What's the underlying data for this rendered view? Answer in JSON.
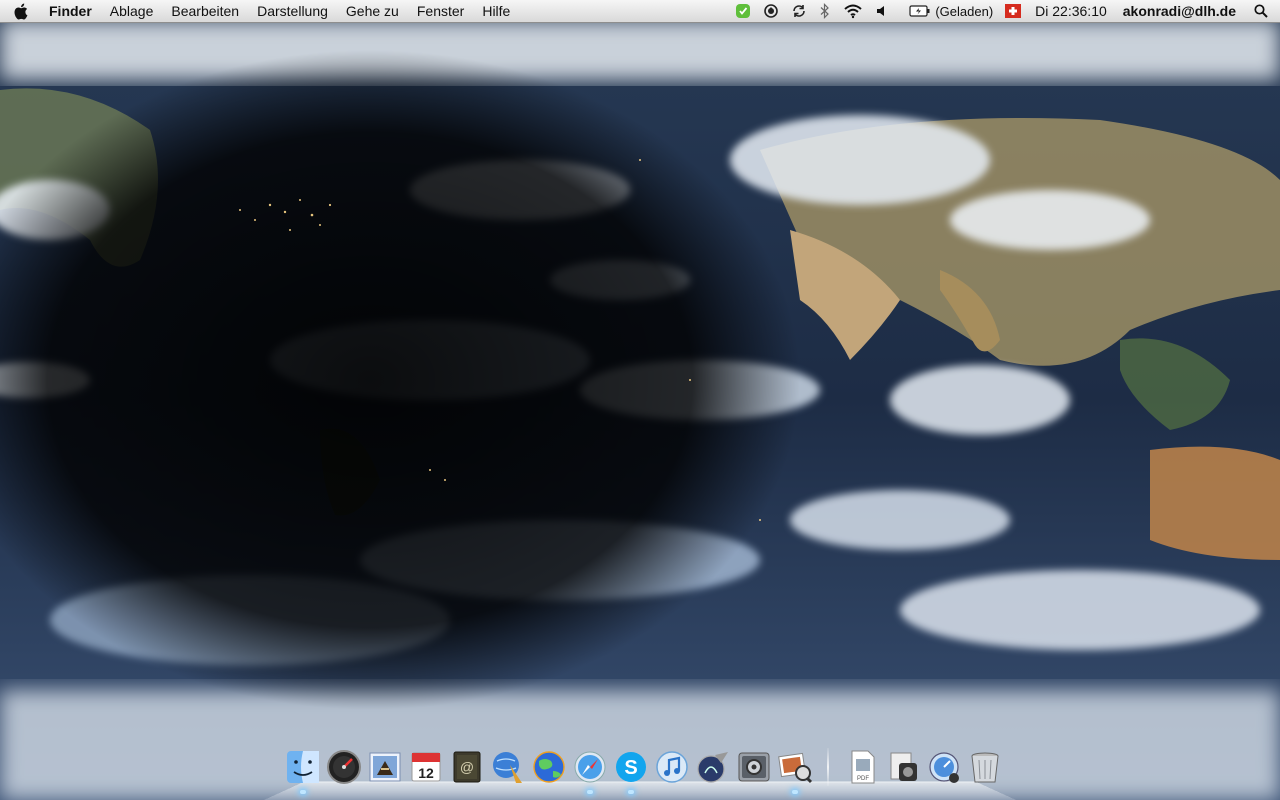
{
  "menubar": {
    "apple_icon": "apple-logo-icon",
    "app_name": "Finder",
    "menus": [
      "Ablage",
      "Bearbeiten",
      "Darstellung",
      "Gehe zu",
      "Fenster",
      "Hilfe"
    ],
    "status_icons": [
      "evernote-icon",
      "time-machine-icon",
      "sync-icon",
      "bluetooth-icon",
      "wifi-icon",
      "volume-icon",
      "battery-icon"
    ],
    "battery_text": "(Geladen)",
    "input_source_icon": "swiss-flag-icon",
    "clock": "Di 22:36:10",
    "user": "akonradi@dlh.de",
    "spotlight_icon": "spotlight-search-icon"
  },
  "dock": {
    "apps": [
      {
        "name": "finder-icon",
        "running": true
      },
      {
        "name": "dashboard-icon",
        "running": false
      },
      {
        "name": "mail-icon",
        "running": false
      },
      {
        "name": "ical-icon",
        "label": "12",
        "running": false
      },
      {
        "name": "address-book-icon",
        "running": false
      },
      {
        "name": "network-utility-icon",
        "running": false
      },
      {
        "name": "globe-icon",
        "running": false
      },
      {
        "name": "safari-icon",
        "running": true
      },
      {
        "name": "skype-icon",
        "running": true
      },
      {
        "name": "itunes-icon",
        "running": false
      },
      {
        "name": "instruments-icon",
        "running": false
      },
      {
        "name": "system-preferences-icon",
        "running": false
      },
      {
        "name": "preview-icon",
        "running": true
      }
    ],
    "documents": [
      {
        "name": "pdf-document-icon"
      },
      {
        "name": "utilities-folder-icon"
      },
      {
        "name": "applications-folder-icon"
      },
      {
        "name": "trash-icon"
      }
    ],
    "pdf_label": "PDF"
  },
  "colors": {
    "menubar_top": "#f6f6f6",
    "menubar_bottom": "#d9d9d9",
    "ocean": "#1c2f4b",
    "night": "#05070c",
    "land": "#b8a07a"
  }
}
